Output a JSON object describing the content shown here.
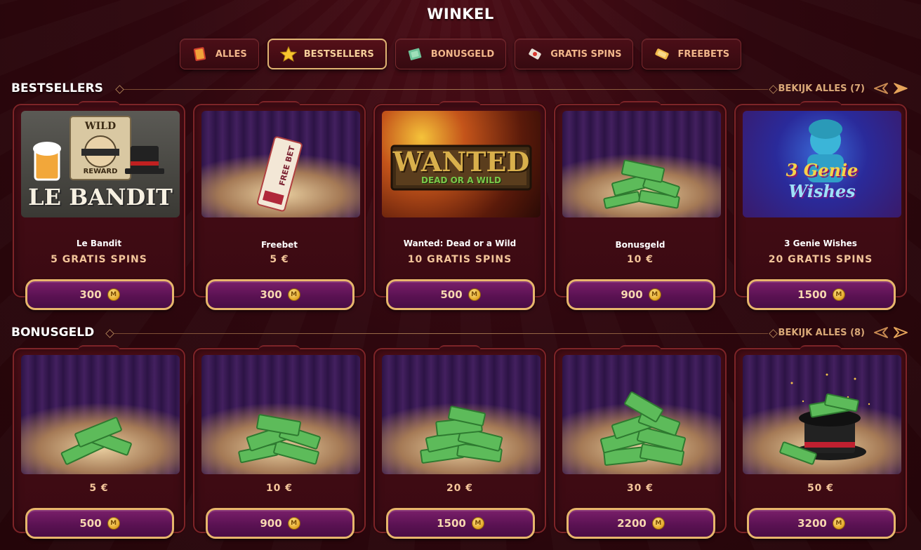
{
  "page": {
    "title": "WINKEL"
  },
  "tabs": [
    {
      "label": "ALLES",
      "icon": "book-icon",
      "active": false
    },
    {
      "label": "BESTSELLERS",
      "icon": "star-icon",
      "active": true
    },
    {
      "label": "BONUSGELD",
      "icon": "money-icon",
      "active": false
    },
    {
      "label": "GRATIS SPINS",
      "icon": "spin-ticket-icon",
      "active": false
    },
    {
      "label": "FREEBETS",
      "icon": "ticket-icon",
      "active": false
    }
  ],
  "bestsellers": {
    "title": "BESTSELLERS",
    "view_all": "BEKIJK ALLES (7)",
    "items": [
      {
        "name": "Le Bandit",
        "value": "5 GRATIS SPINS",
        "price": "300",
        "art_title": "LE BANDIT",
        "art_sub": "WILD",
        "art_sub2": "REWARD"
      },
      {
        "name": "Freebet",
        "value": "5 €",
        "price": "300",
        "art_title": "FREE BET"
      },
      {
        "name": "Wanted: Dead or a Wild",
        "value": "10 GRATIS SPINS",
        "price": "500",
        "art_title": "WANTED",
        "art_sub": "DEAD OR A WILD"
      },
      {
        "name": "Bonusgeld",
        "value": "10 €",
        "price": "900"
      },
      {
        "name": "3 Genie Wishes",
        "value": "20 GRATIS SPINS",
        "price": "1500",
        "art_title": "3 Genie",
        "art_sub": "Wishes"
      }
    ]
  },
  "bonusgeld": {
    "title": "BONUSGELD",
    "view_all": "BEKIJK ALLES (8)",
    "items": [
      {
        "value": "5 €",
        "price": "500"
      },
      {
        "value": "10 €",
        "price": "900"
      },
      {
        "value": "20 €",
        "price": "1500"
      },
      {
        "value": "30 €",
        "price": "2200"
      },
      {
        "value": "50 €",
        "price": "3200"
      }
    ]
  },
  "coin_symbol": "M",
  "colors": {
    "accent_gold": "#e8b66c",
    "button_purple": "#5b1253",
    "background": "#2e070e",
    "card_border": "#7d2428"
  }
}
